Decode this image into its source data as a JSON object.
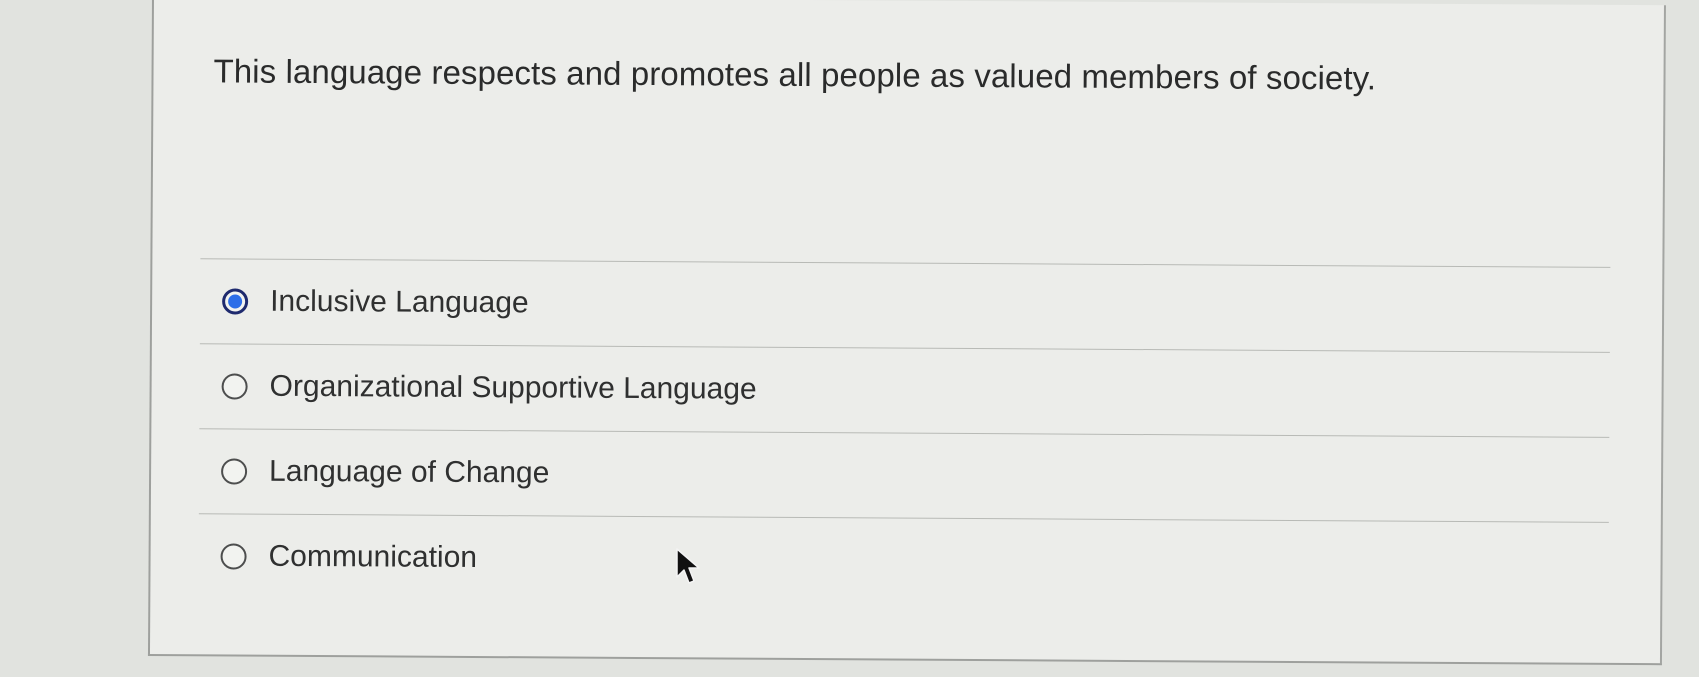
{
  "question": {
    "text": "This language respects and promotes all people as valued members of society."
  },
  "options": [
    {
      "label": "Inclusive Language",
      "selected": true
    },
    {
      "label": "Organizational Supportive Language",
      "selected": false
    },
    {
      "label": "Language of Change",
      "selected": false
    },
    {
      "label": "Communication",
      "selected": false
    }
  ],
  "colors": {
    "selected_radio": "#2d6ee8",
    "text": "#2f3030"
  }
}
